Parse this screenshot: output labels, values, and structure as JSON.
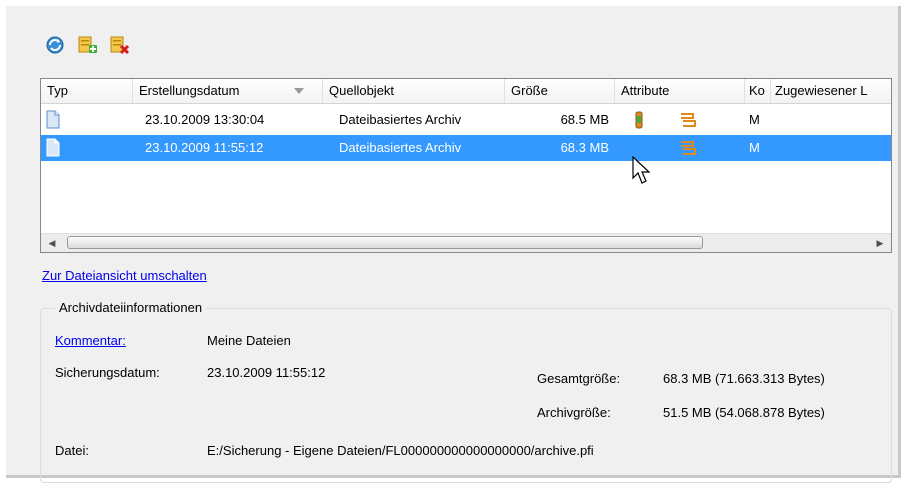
{
  "toolbar": {
    "buttons": [
      {
        "icon": "refresh-icon",
        "label": ""
      },
      {
        "icon": "add-archive-icon",
        "label": ""
      },
      {
        "icon": "delete-archive-icon",
        "label": ""
      }
    ]
  },
  "list": {
    "columns": [
      "Typ",
      "Erstellungsdatum",
      "Quellobjekt",
      "Größe",
      "Attribute",
      "Ko",
      "Zugewiesener L"
    ],
    "sorted_column": "Erstellungsdatum",
    "rows": [
      {
        "date": "23.10.2009 13:30:04",
        "source": "Dateibasiertes Archiv",
        "size": "68.5 MB",
        "ko": "M",
        "assigned": "",
        "selected": false
      },
      {
        "date": "23.10.2009 11:55:12",
        "source": "Dateibasiertes Archiv",
        "size": "68.3 MB",
        "ko": "M",
        "assigned": "",
        "selected": true
      }
    ]
  },
  "toggle_view_link": "Zur Dateiansicht umschalten",
  "info": {
    "title": "Archivdateiinformationen",
    "comment_label": "Kommentar:",
    "comment_value": "Meine Dateien",
    "backup_date_label": "Sicherungsdatum:",
    "backup_date_value": "23.10.2009 11:55:12",
    "total_size_label": "Gesamtgröße:",
    "total_size_value": "68.3 MB (71.663.313 Bytes)",
    "archive_size_label": "Archivgröße:",
    "archive_size_value": "51.5 MB (54.068.878 Bytes)",
    "file_label": "Datei:",
    "file_value": "E:/Sicherung - Eigene Dateien/FL000000000000000000/archive.pfi"
  },
  "colors": {
    "selection": "#3399ff",
    "link": "#0000ee",
    "attr_orange": "#e08a1e"
  }
}
